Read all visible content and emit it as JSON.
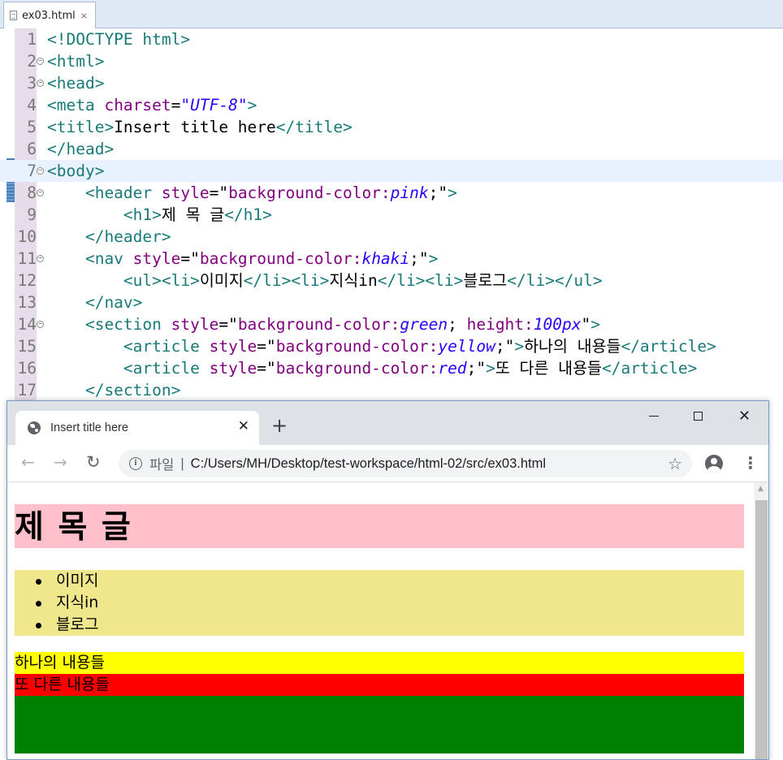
{
  "editor": {
    "tab_label": "ex03.html",
    "tab_close": "⨯",
    "lines": [
      {
        "n": "1",
        "fold": false,
        "current": false,
        "parts": [
          {
            "t": "<!DOCTYPE ",
            "c": "t"
          },
          {
            "t": "html",
            "c": "t"
          },
          {
            "t": ">",
            "c": "t"
          }
        ]
      },
      {
        "n": "2",
        "fold": true,
        "current": false,
        "parts": [
          {
            "t": "<html>",
            "c": "t"
          }
        ]
      },
      {
        "n": "3",
        "fold": true,
        "current": false,
        "parts": [
          {
            "t": "<head>",
            "c": "t"
          }
        ]
      },
      {
        "n": "4",
        "fold": false,
        "current": false,
        "parts": [
          {
            "t": "<meta ",
            "c": "t"
          },
          {
            "t": "charset",
            "c": "a"
          },
          {
            "t": "=",
            "c": "txt"
          },
          {
            "t": "\"UTF-8\"",
            "c": "v"
          },
          {
            "t": ">",
            "c": "t"
          }
        ]
      },
      {
        "n": "5",
        "fold": false,
        "current": false,
        "parts": [
          {
            "t": "<title>",
            "c": "t"
          },
          {
            "t": "Insert title here",
            "c": "txt"
          },
          {
            "t": "</title>",
            "c": "t"
          }
        ]
      },
      {
        "n": "6",
        "fold": false,
        "current": false,
        "parts": [
          {
            "t": "</head>",
            "c": "t"
          }
        ]
      },
      {
        "n": "7",
        "fold": true,
        "current": true,
        "parts": [
          {
            "t": "<body>",
            "c": "t"
          }
        ]
      },
      {
        "n": "8",
        "fold": true,
        "current": false,
        "parts": [
          {
            "t": "    <header ",
            "c": "t"
          },
          {
            "t": "style",
            "c": "a"
          },
          {
            "t": "=\"",
            "c": "txt"
          },
          {
            "t": "background-color:",
            "c": "a"
          },
          {
            "t": "pink",
            "c": "v"
          },
          {
            "t": ";\"",
            "c": "txt"
          },
          {
            "t": ">",
            "c": "t"
          }
        ]
      },
      {
        "n": "9",
        "fold": false,
        "current": false,
        "parts": [
          {
            "t": "        <h1>",
            "c": "t"
          },
          {
            "t": "제 목 글",
            "c": "txt"
          },
          {
            "t": "</h1>",
            "c": "t"
          }
        ]
      },
      {
        "n": "10",
        "fold": false,
        "current": false,
        "parts": [
          {
            "t": "    </header>",
            "c": "t"
          }
        ]
      },
      {
        "n": "11",
        "fold": true,
        "current": false,
        "parts": [
          {
            "t": "    <nav ",
            "c": "t"
          },
          {
            "t": "style",
            "c": "a"
          },
          {
            "t": "=\"",
            "c": "txt"
          },
          {
            "t": "background-color:",
            "c": "a"
          },
          {
            "t": "khaki",
            "c": "v"
          },
          {
            "t": ";\"",
            "c": "txt"
          },
          {
            "t": ">",
            "c": "t"
          }
        ]
      },
      {
        "n": "12",
        "fold": false,
        "current": false,
        "parts": [
          {
            "t": "        <ul><li>",
            "c": "t"
          },
          {
            "t": "이미지",
            "c": "txt"
          },
          {
            "t": "</li><li>",
            "c": "t"
          },
          {
            "t": "지식in",
            "c": "txt"
          },
          {
            "t": "</li><li>",
            "c": "t"
          },
          {
            "t": "블로그",
            "c": "txt"
          },
          {
            "t": "</li></ul>",
            "c": "t"
          }
        ]
      },
      {
        "n": "13",
        "fold": false,
        "current": false,
        "parts": [
          {
            "t": "    </nav>",
            "c": "t"
          }
        ]
      },
      {
        "n": "14",
        "fold": true,
        "current": false,
        "parts": [
          {
            "t": "    <section ",
            "c": "t"
          },
          {
            "t": "style",
            "c": "a"
          },
          {
            "t": "=\"",
            "c": "txt"
          },
          {
            "t": "background-color:",
            "c": "a"
          },
          {
            "t": "green",
            "c": "v"
          },
          {
            "t": "; ",
            "c": "txt"
          },
          {
            "t": "height:",
            "c": "a"
          },
          {
            "t": "100px",
            "c": "v"
          },
          {
            "t": "\"",
            "c": "txt"
          },
          {
            "t": ">",
            "c": "t"
          }
        ]
      },
      {
        "n": "15",
        "fold": false,
        "current": false,
        "parts": [
          {
            "t": "        <article ",
            "c": "t"
          },
          {
            "t": "style",
            "c": "a"
          },
          {
            "t": "=\"",
            "c": "txt"
          },
          {
            "t": "background-color:",
            "c": "a"
          },
          {
            "t": "yellow",
            "c": "v"
          },
          {
            "t": ";\"",
            "c": "txt"
          },
          {
            "t": ">",
            "c": "t"
          },
          {
            "t": "하나의 내용들",
            "c": "txt"
          },
          {
            "t": "</article>",
            "c": "t"
          }
        ]
      },
      {
        "n": "16",
        "fold": false,
        "current": false,
        "parts": [
          {
            "t": "        <article ",
            "c": "t"
          },
          {
            "t": "style",
            "c": "a"
          },
          {
            "t": "=\"",
            "c": "txt"
          },
          {
            "t": "background-color:",
            "c": "a"
          },
          {
            "t": "red",
            "c": "v"
          },
          {
            "t": ";\"",
            "c": "txt"
          },
          {
            "t": ">",
            "c": "t"
          },
          {
            "t": "또 다른 내용들",
            "c": "txt"
          },
          {
            "t": "</article>",
            "c": "t"
          }
        ]
      },
      {
        "n": "17",
        "fold": false,
        "current": false,
        "parts": [
          {
            "t": "    </section>",
            "c": "t"
          }
        ]
      }
    ]
  },
  "browser": {
    "tab_title": "Insert title here",
    "tab_close": "✕",
    "new_tab": "+",
    "window": {
      "close": "✕"
    },
    "nav": {
      "back": "←",
      "forward": "→",
      "reload": "↻"
    },
    "address": {
      "info": "i",
      "scheme": "파일",
      "separator": "|",
      "url": "C:/Users/MH/Desktop/test-workspace/html-02/src/ex03.html"
    },
    "star": "☆",
    "menu": "⋮",
    "scroll_up": "▲"
  },
  "page": {
    "header": {
      "h1": "제 목 글",
      "bg": "#ffc0cb"
    },
    "nav": {
      "items": [
        "이미지",
        "지식in",
        "블로그"
      ],
      "bg": "#f0e68c"
    },
    "section": {
      "bg": "#008000",
      "articles": [
        {
          "text": "하나의 내용들",
          "bg": "#ffff00"
        },
        {
          "text": "또 다른 내용들",
          "bg": "#ff0000"
        }
      ]
    }
  },
  "colors": {
    "tag": "#1a7a7a",
    "attr": "#7f007f",
    "value": "#2a00ff",
    "current_line": "#e8f2fe",
    "ruler": "#e6dcea"
  }
}
